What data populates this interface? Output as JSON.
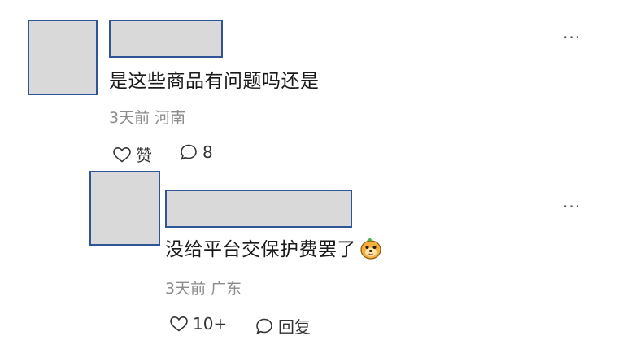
{
  "comments": [
    {
      "text": "是这些商品有问题吗还是",
      "time": "3天前",
      "location": "河南",
      "like_label": "赞",
      "reply_count": "8",
      "more_label": "···"
    },
    {
      "text": "没给平台交保护费罢了",
      "emoji": "doge-emoji",
      "time": "3天前",
      "location": "广东",
      "like_count": "10+",
      "reply_label": "回复",
      "more_label": "···"
    }
  ],
  "colors": {
    "placeholder_fill": "#d9d9d9",
    "placeholder_border": "#2f5597",
    "meta_text": "#8c8c8c",
    "body_text": "#1a1a1a"
  }
}
